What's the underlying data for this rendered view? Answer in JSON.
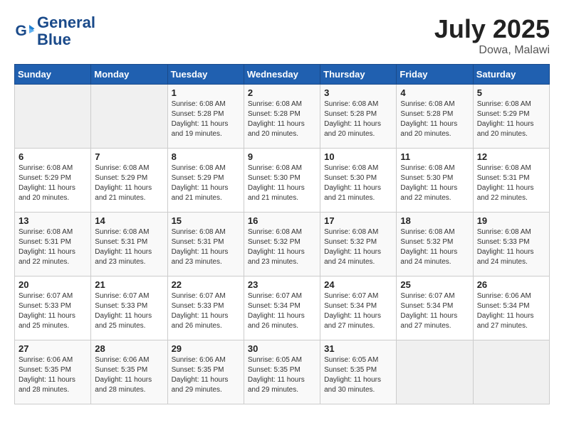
{
  "header": {
    "logo_line1": "General",
    "logo_line2": "Blue",
    "month": "July 2025",
    "location": "Dowa, Malawi"
  },
  "weekdays": [
    "Sunday",
    "Monday",
    "Tuesday",
    "Wednesday",
    "Thursday",
    "Friday",
    "Saturday"
  ],
  "weeks": [
    [
      {
        "day": "",
        "info": ""
      },
      {
        "day": "",
        "info": ""
      },
      {
        "day": "1",
        "info": "Sunrise: 6:08 AM\nSunset: 5:28 PM\nDaylight: 11 hours and 19 minutes."
      },
      {
        "day": "2",
        "info": "Sunrise: 6:08 AM\nSunset: 5:28 PM\nDaylight: 11 hours and 20 minutes."
      },
      {
        "day": "3",
        "info": "Sunrise: 6:08 AM\nSunset: 5:28 PM\nDaylight: 11 hours and 20 minutes."
      },
      {
        "day": "4",
        "info": "Sunrise: 6:08 AM\nSunset: 5:28 PM\nDaylight: 11 hours and 20 minutes."
      },
      {
        "day": "5",
        "info": "Sunrise: 6:08 AM\nSunset: 5:29 PM\nDaylight: 11 hours and 20 minutes."
      }
    ],
    [
      {
        "day": "6",
        "info": "Sunrise: 6:08 AM\nSunset: 5:29 PM\nDaylight: 11 hours and 20 minutes."
      },
      {
        "day": "7",
        "info": "Sunrise: 6:08 AM\nSunset: 5:29 PM\nDaylight: 11 hours and 21 minutes."
      },
      {
        "day": "8",
        "info": "Sunrise: 6:08 AM\nSunset: 5:29 PM\nDaylight: 11 hours and 21 minutes."
      },
      {
        "day": "9",
        "info": "Sunrise: 6:08 AM\nSunset: 5:30 PM\nDaylight: 11 hours and 21 minutes."
      },
      {
        "day": "10",
        "info": "Sunrise: 6:08 AM\nSunset: 5:30 PM\nDaylight: 11 hours and 21 minutes."
      },
      {
        "day": "11",
        "info": "Sunrise: 6:08 AM\nSunset: 5:30 PM\nDaylight: 11 hours and 22 minutes."
      },
      {
        "day": "12",
        "info": "Sunrise: 6:08 AM\nSunset: 5:31 PM\nDaylight: 11 hours and 22 minutes."
      }
    ],
    [
      {
        "day": "13",
        "info": "Sunrise: 6:08 AM\nSunset: 5:31 PM\nDaylight: 11 hours and 22 minutes."
      },
      {
        "day": "14",
        "info": "Sunrise: 6:08 AM\nSunset: 5:31 PM\nDaylight: 11 hours and 23 minutes."
      },
      {
        "day": "15",
        "info": "Sunrise: 6:08 AM\nSunset: 5:31 PM\nDaylight: 11 hours and 23 minutes."
      },
      {
        "day": "16",
        "info": "Sunrise: 6:08 AM\nSunset: 5:32 PM\nDaylight: 11 hours and 23 minutes."
      },
      {
        "day": "17",
        "info": "Sunrise: 6:08 AM\nSunset: 5:32 PM\nDaylight: 11 hours and 24 minutes."
      },
      {
        "day": "18",
        "info": "Sunrise: 6:08 AM\nSunset: 5:32 PM\nDaylight: 11 hours and 24 minutes."
      },
      {
        "day": "19",
        "info": "Sunrise: 6:08 AM\nSunset: 5:33 PM\nDaylight: 11 hours and 24 minutes."
      }
    ],
    [
      {
        "day": "20",
        "info": "Sunrise: 6:07 AM\nSunset: 5:33 PM\nDaylight: 11 hours and 25 minutes."
      },
      {
        "day": "21",
        "info": "Sunrise: 6:07 AM\nSunset: 5:33 PM\nDaylight: 11 hours and 25 minutes."
      },
      {
        "day": "22",
        "info": "Sunrise: 6:07 AM\nSunset: 5:33 PM\nDaylight: 11 hours and 26 minutes."
      },
      {
        "day": "23",
        "info": "Sunrise: 6:07 AM\nSunset: 5:34 PM\nDaylight: 11 hours and 26 minutes."
      },
      {
        "day": "24",
        "info": "Sunrise: 6:07 AM\nSunset: 5:34 PM\nDaylight: 11 hours and 27 minutes."
      },
      {
        "day": "25",
        "info": "Sunrise: 6:07 AM\nSunset: 5:34 PM\nDaylight: 11 hours and 27 minutes."
      },
      {
        "day": "26",
        "info": "Sunrise: 6:06 AM\nSunset: 5:34 PM\nDaylight: 11 hours and 27 minutes."
      }
    ],
    [
      {
        "day": "27",
        "info": "Sunrise: 6:06 AM\nSunset: 5:35 PM\nDaylight: 11 hours and 28 minutes."
      },
      {
        "day": "28",
        "info": "Sunrise: 6:06 AM\nSunset: 5:35 PM\nDaylight: 11 hours and 28 minutes."
      },
      {
        "day": "29",
        "info": "Sunrise: 6:06 AM\nSunset: 5:35 PM\nDaylight: 11 hours and 29 minutes."
      },
      {
        "day": "30",
        "info": "Sunrise: 6:05 AM\nSunset: 5:35 PM\nDaylight: 11 hours and 29 minutes."
      },
      {
        "day": "31",
        "info": "Sunrise: 6:05 AM\nSunset: 5:35 PM\nDaylight: 11 hours and 30 minutes."
      },
      {
        "day": "",
        "info": ""
      },
      {
        "day": "",
        "info": ""
      }
    ]
  ]
}
